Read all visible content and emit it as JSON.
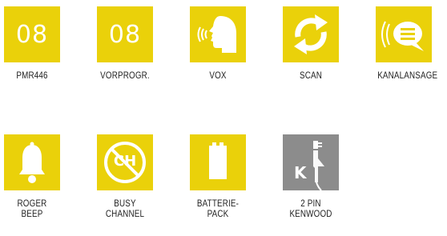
{
  "colors": {
    "tile_yellow": "#EAD10A",
    "tile_grey": "#8C8C8C",
    "icon_white": "#FFFFFF"
  },
  "features": [
    {
      "id": "pmr446",
      "label": "PMR446",
      "tile_text": "08",
      "icon": "number-tile"
    },
    {
      "id": "vorprogr",
      "label": "VORPROGR.",
      "tile_text": "08",
      "icon": "number-tile"
    },
    {
      "id": "vox",
      "label": "VOX",
      "icon": "speaking-head-icon"
    },
    {
      "id": "scan",
      "label": "SCAN",
      "icon": "circular-arrows-icon"
    },
    {
      "id": "kanalansage",
      "label": "KANALANSAGE",
      "icon": "speech-bubble-icon"
    },
    {
      "id": "roger-beep",
      "label": "ROGER BEEP",
      "icon": "bell-icon"
    },
    {
      "id": "busy-channel",
      "label": "BUSY CHANNEL",
      "tile_text": "CH",
      "icon": "no-channel-icon"
    },
    {
      "id": "batteriepack",
      "label": "BATTERIE-\nPACK",
      "icon": "battery-icon"
    },
    {
      "id": "2pin-kenwood",
      "label": "2 PIN\nKENWOOD",
      "tile_text": "K",
      "icon": "earpiece-plug-icon"
    }
  ]
}
